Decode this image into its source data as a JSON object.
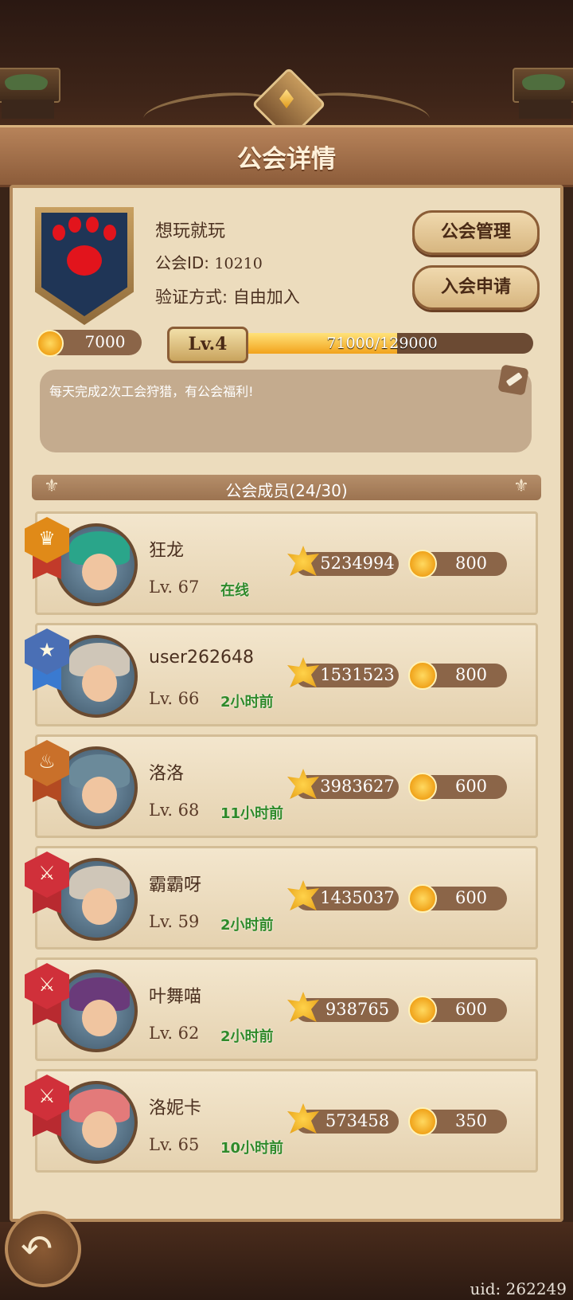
{
  "header": {
    "title": "公会详情"
  },
  "guild": {
    "name": "想玩就玩",
    "id_label": "公会ID:",
    "id_value": "10210",
    "verify_text": "验证方式: 自由加入",
    "gold": "7000",
    "level": "Lv.4",
    "xp_text": "71000/129000",
    "xp_fraction": 0.55,
    "notice": "每天完成2次工会狩猎，有公会福利!",
    "emblem_color": "#1f3556",
    "paw_color": "#e2141c"
  },
  "buttons": {
    "manage": "公会管理",
    "apply": "入会申请"
  },
  "members_title": "公会成员(24/30)",
  "members": [
    {
      "name": "狂龙",
      "level": "Lv. 67",
      "status": "在线",
      "power": "5234994",
      "contrib": "800",
      "rank_icon": "crown-icon",
      "rank_color": "#e08a18",
      "ribbon": "#c23a2a",
      "hair": "#2aa58a"
    },
    {
      "name": "user262648",
      "level": "Lv. 66",
      "status": "2小时前",
      "power": "1531523",
      "contrib": "800",
      "rank_icon": "star-icon",
      "rank_color": "#4a6fb5",
      "ribbon": "#3a7ad0",
      "hair": "#cfc6b8"
    },
    {
      "name": "洛洛",
      "level": "Lv. 68",
      "status": "11小时前",
      "power": "3983627",
      "contrib": "600",
      "rank_icon": "flame-icon",
      "rank_color": "#c9702a",
      "ribbon": "#b34a22",
      "hair": "#6b8a9a"
    },
    {
      "name": "霸霸呀",
      "level": "Lv. 59",
      "status": "2小时前",
      "power": "1435037",
      "contrib": "600",
      "rank_icon": "swords-icon",
      "rank_color": "#d0303a",
      "ribbon": "#b82a30",
      "hair": "#cfc6b8"
    },
    {
      "name": "叶舞喵",
      "level": "Lv. 62",
      "status": "2小时前",
      "power": "938765",
      "contrib": "600",
      "rank_icon": "swords-icon",
      "rank_color": "#d0303a",
      "ribbon": "#b82a30",
      "hair": "#6a3a7a"
    },
    {
      "name": "洛妮卡",
      "level": "Lv. 65",
      "status": "10小时前",
      "power": "573458",
      "contrib": "350",
      "rank_icon": "swords-icon",
      "rank_color": "#d0303a",
      "ribbon": "#b82a30",
      "hair": "#e37a7a"
    }
  ],
  "footer": {
    "uid": "uid: 262249"
  }
}
